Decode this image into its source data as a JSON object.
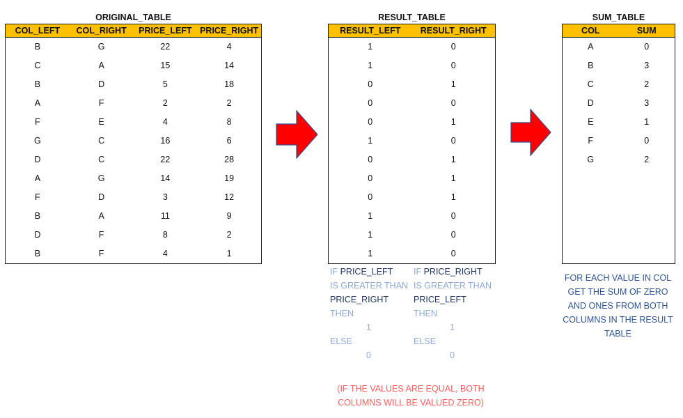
{
  "original_table": {
    "title": "ORIGINAL_TABLE",
    "headers": [
      "COL_LEFT",
      "COL_RIGHT",
      "PRICE_LEFT",
      "PRICE_RIGHT"
    ],
    "rows": [
      [
        "B",
        "G",
        "22",
        "4"
      ],
      [
        "C",
        "A",
        "15",
        "14"
      ],
      [
        "B",
        "D",
        "5",
        "18"
      ],
      [
        "A",
        "F",
        "2",
        "2"
      ],
      [
        "F",
        "E",
        "4",
        "8"
      ],
      [
        "G",
        "C",
        "16",
        "6"
      ],
      [
        "D",
        "C",
        "22",
        "28"
      ],
      [
        "A",
        "G",
        "14",
        "19"
      ],
      [
        "F",
        "D",
        "3",
        "12"
      ],
      [
        "B",
        "A",
        "11",
        "9"
      ],
      [
        "D",
        "F",
        "8",
        "2"
      ],
      [
        "B",
        "F",
        "4",
        "1"
      ]
    ]
  },
  "result_table": {
    "title": "RESULT_TABLE",
    "headers": [
      "RESULT_LEFT",
      "RESULT_RIGHT"
    ],
    "rows": [
      [
        "1",
        "0"
      ],
      [
        "1",
        "0"
      ],
      [
        "0",
        "1"
      ],
      [
        "0",
        "0"
      ],
      [
        "0",
        "1"
      ],
      [
        "1",
        "0"
      ],
      [
        "0",
        "1"
      ],
      [
        "0",
        "1"
      ],
      [
        "0",
        "1"
      ],
      [
        "1",
        "0"
      ],
      [
        "1",
        "0"
      ],
      [
        "1",
        "0"
      ]
    ]
  },
  "sum_table": {
    "title": "SUM_TABLE",
    "headers": [
      "COL",
      "SUM"
    ],
    "rows": [
      [
        "A",
        "0"
      ],
      [
        "B",
        "3"
      ],
      [
        "C",
        "2"
      ],
      [
        "D",
        "3"
      ],
      [
        "E",
        "1"
      ],
      [
        "F",
        "0"
      ],
      [
        "G",
        "2"
      ]
    ]
  },
  "rules": {
    "left": {
      "if": "IF",
      "field_a": "PRICE_LEFT",
      "comparison": "IS GREATER THAN",
      "field_b": "PRICE_RIGHT",
      "then": "THEN",
      "then_value": "1",
      "else": "ELSE",
      "else_value": "0"
    },
    "right": {
      "if": "IF",
      "field_a": "PRICE_RIGHT",
      "comparison": "IS GREATER THAN",
      "field_b": "PRICE_LEFT",
      "then": "THEN",
      "then_value": "1",
      "else": "ELSE",
      "else_value": "0"
    }
  },
  "notes": {
    "equal_note_line1": "(IF THE VALUES ARE EQUAL, BOTH",
    "equal_note_line2": "COLUMNS WILL BE VALUED ZERO)",
    "sum_note_lines": [
      "FOR EACH VALUE IN COL",
      "GET THE SUM OF ZERO",
      "AND ONES FROM BOTH",
      "COLUMNS IN THE RESULT",
      "TABLE"
    ]
  },
  "icons": {
    "arrow1": "right-arrow-icon",
    "arrow2": "right-arrow-icon"
  },
  "colors": {
    "header_fill": "#ffc000",
    "arrow_fill": "#ff0000",
    "arrow_stroke": "#2f4f8f",
    "keyword": "#8eaadb",
    "field": "#1f3864",
    "equal_note": "#ff5f5f",
    "sum_note": "#2f5597"
  }
}
